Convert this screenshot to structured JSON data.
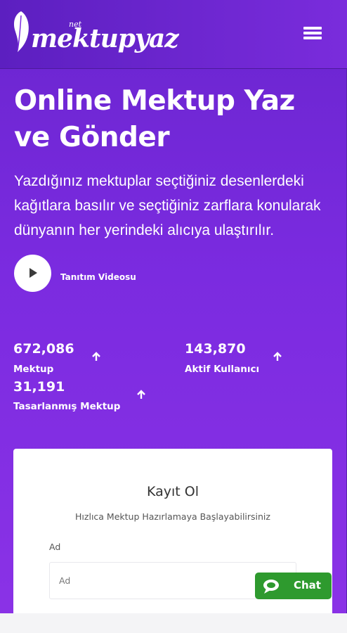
{
  "header": {
    "logo": {
      "text": "mektupyaz",
      "superscript": "net"
    },
    "menu_icon": "hamburger-menu-icon"
  },
  "hero": {
    "title_line1": "Online Mektup Yaz",
    "title_line2": "ve Gönder",
    "description": "Yazdığınız mektuplar seçtiğiniz desenlerdeki kağıtlara basılır ve seçtiğiniz zarflara konularak dünyanın her yerindeki alıcıya ulaştırılır.",
    "video_label": "Tanıtım Videosu"
  },
  "stats": [
    {
      "value": "672,086",
      "label": "Mektup"
    },
    {
      "value": "143,870",
      "label": "Aktif Kullanıcı"
    },
    {
      "value": "31,191",
      "label": "Tasarlanmış Mektup"
    }
  ],
  "register": {
    "title": "Kayıt Ol",
    "subtitle": "Hızlıca Mektup Hazırlamaya Başlayabilirsiniz",
    "name_label": "Ad",
    "name_placeholder": "Ad"
  },
  "chat": {
    "label": "Chat"
  },
  "colors": {
    "hero_bg_start": "#6a25cf",
    "hero_bg_end": "#8a32e6",
    "chat_green": "#2e9a2e"
  }
}
